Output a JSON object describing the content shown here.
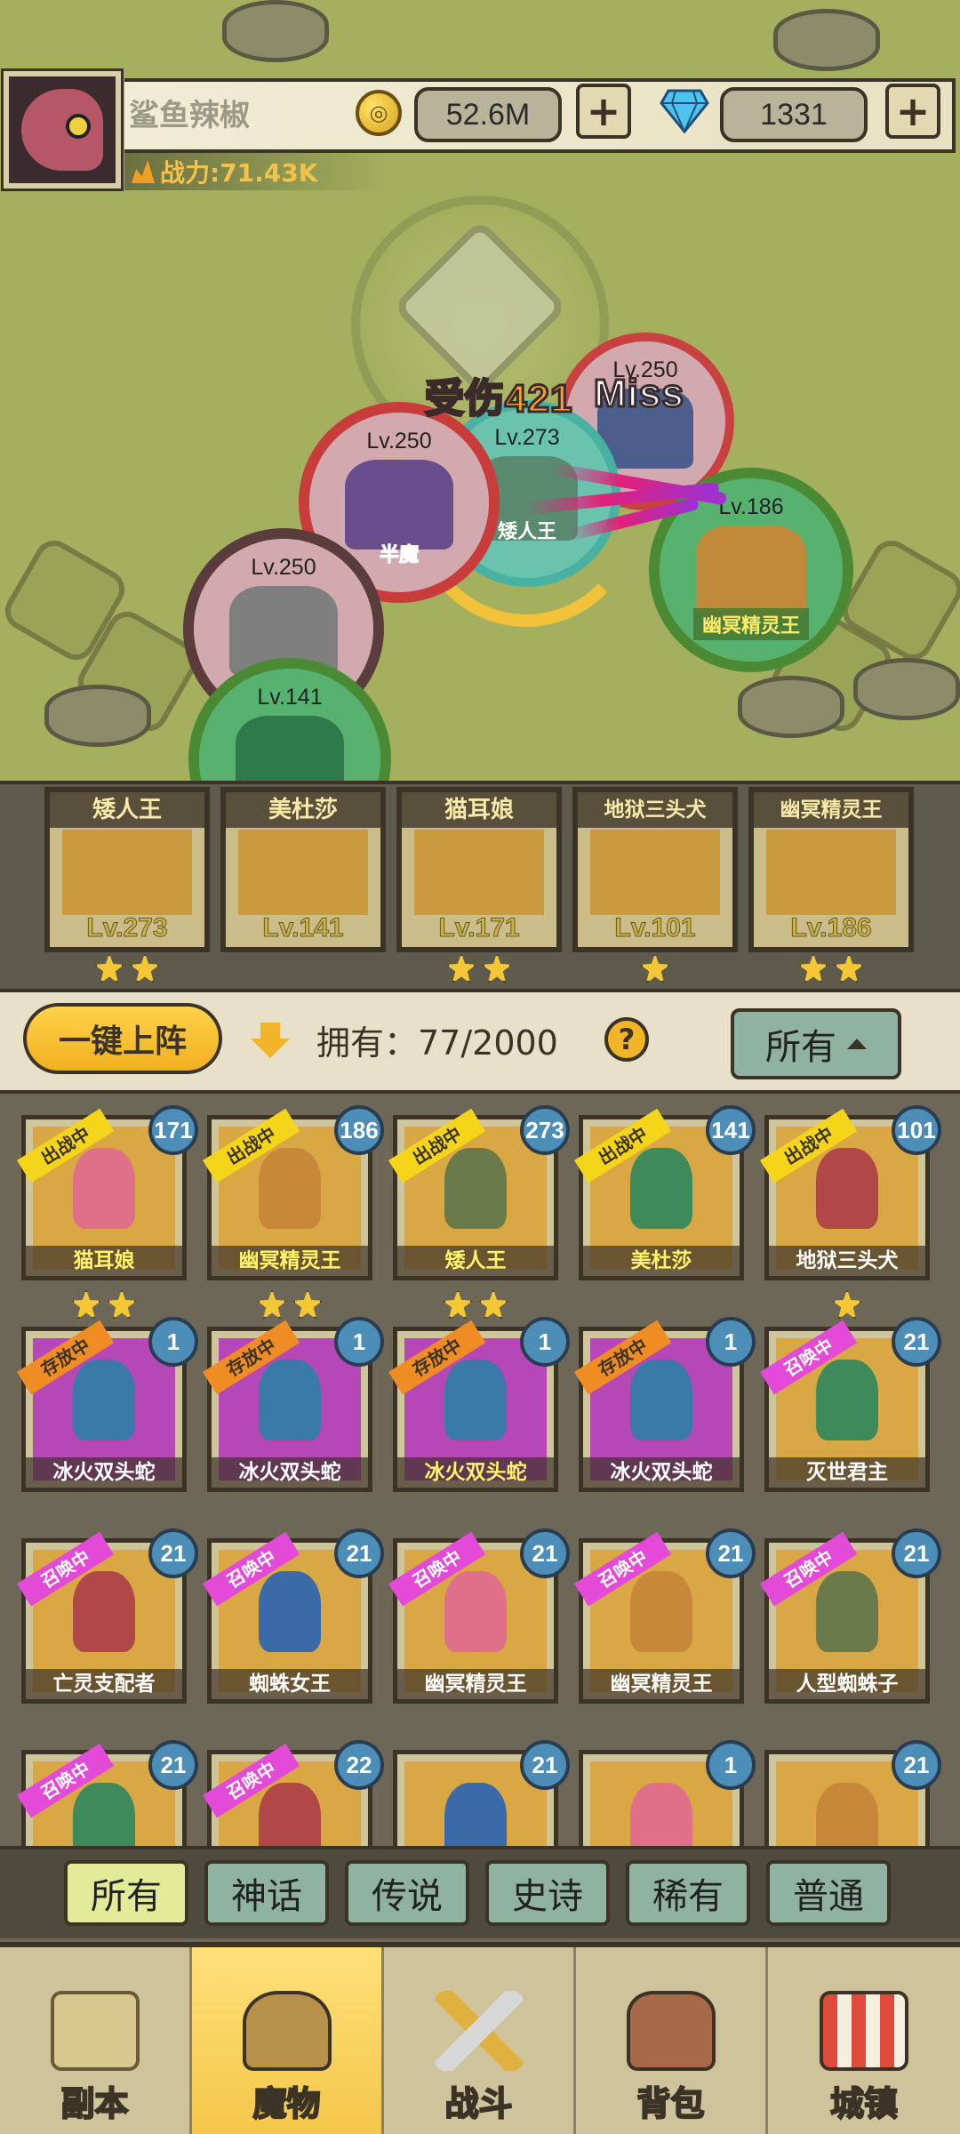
{
  "player": {
    "name": "鲨鱼辣椒",
    "power": "战力:71.43K",
    "gold": "52.6M",
    "gems": "1331",
    "add_gold_label": "+",
    "add_gems_label": "+",
    "coin_glyph": "◎"
  },
  "battle": {
    "floating_damage": "受伤421",
    "miss_text": "Miss",
    "units": [
      {
        "lv": "Lv.250",
        "name": ""
      },
      {
        "lv": "Lv.250",
        "name": "半魔"
      },
      {
        "lv": "Lv.273",
        "name": "矮人王"
      },
      {
        "lv": "Lv.250",
        "name": ""
      },
      {
        "lv": "Lv.186",
        "name": "幽冥精灵王"
      },
      {
        "lv": "Lv.141",
        "name": ""
      }
    ]
  },
  "lineup": [
    {
      "name": "矮人王",
      "lv": "Lv.273",
      "stars": 2
    },
    {
      "name": "美杜莎",
      "lv": "Lv.141",
      "stars": 0
    },
    {
      "name": "猫耳娘",
      "lv": "Lv.171",
      "stars": 2
    },
    {
      "name": "地狱三头犬",
      "lv": "Lv.101",
      "stars": 1
    },
    {
      "name": "幽冥精灵王",
      "lv": "Lv.186",
      "stars": 2
    }
  ],
  "inventory": {
    "one_key_label": "一键上阵",
    "own_text": "拥有：77/2000",
    "help_label": "?",
    "filter_label": "所有",
    "rows": [
      [
        {
          "name": "猫耳娘",
          "tag": "出战中",
          "lv": "171",
          "stars": 2
        },
        {
          "name": "幽冥精灵王",
          "tag": "出战中",
          "lv": "186",
          "stars": 2
        },
        {
          "name": "矮人王",
          "tag": "出战中",
          "lv": "273",
          "stars": 2
        },
        {
          "name": "美杜莎",
          "tag": "出战中",
          "lv": "141",
          "stars": 0
        },
        {
          "name": "地狱三头犬",
          "tag": "出战中",
          "lv": "101",
          "stars": 1
        }
      ],
      [
        {
          "name": "冰火双头蛇",
          "tag": "存放中",
          "lv": "1",
          "stars": 0
        },
        {
          "name": "冰火双头蛇",
          "tag": "存放中",
          "lv": "1",
          "stars": 0
        },
        {
          "name": "冰火双头蛇",
          "tag": "存放中",
          "lv": "1",
          "stars": 0
        },
        {
          "name": "冰火双头蛇",
          "tag": "存放中",
          "lv": "1",
          "stars": 0
        },
        {
          "name": "灭世君主",
          "tag": "召唤中",
          "lv": "21",
          "stars": 0
        }
      ],
      [
        {
          "name": "亡灵支配者",
          "tag": "召唤中",
          "lv": "21",
          "stars": 0
        },
        {
          "name": "蜘蛛女王",
          "tag": "召唤中",
          "lv": "21",
          "stars": 0
        },
        {
          "name": "幽冥精灵王",
          "tag": "召唤中",
          "lv": "21",
          "stars": 0
        },
        {
          "name": "幽冥精灵王",
          "tag": "召唤中",
          "lv": "21",
          "stars": 0
        },
        {
          "name": "人型蜘蛛子",
          "tag": "召唤中",
          "lv": "21",
          "stars": 0
        }
      ],
      [
        {
          "name": "",
          "tag": "召唤中",
          "lv": "21",
          "stars": 0
        },
        {
          "name": "",
          "tag": "召唤中",
          "lv": "22",
          "stars": 0
        },
        {
          "name": "",
          "tag": "",
          "lv": "21",
          "stars": 0
        },
        {
          "name": "",
          "tag": "",
          "lv": "1",
          "stars": 0
        },
        {
          "name": "",
          "tag": "",
          "lv": "21",
          "stars": 0
        }
      ]
    ]
  },
  "rarity_filters": [
    "所有",
    "神话",
    "传说",
    "史诗",
    "稀有",
    "普通"
  ],
  "active_rarity": "所有",
  "bottom_nav": [
    {
      "label": "副本",
      "icon": "map-icon"
    },
    {
      "label": "魔物",
      "icon": "monster-helmet-icon"
    },
    {
      "label": "战斗",
      "icon": "crossed-swords-icon"
    },
    {
      "label": "背包",
      "icon": "backpack-icon"
    },
    {
      "label": "城镇",
      "icon": "town-shop-icon"
    }
  ],
  "active_nav": "魔物",
  "colors": {
    "accent_yellow": "#f5c735",
    "active_tag": "#f5d51a",
    "stored_tag": "#f08c24",
    "summoning_tag": "#e44ad8",
    "level_badge": "#4c8eb8"
  }
}
